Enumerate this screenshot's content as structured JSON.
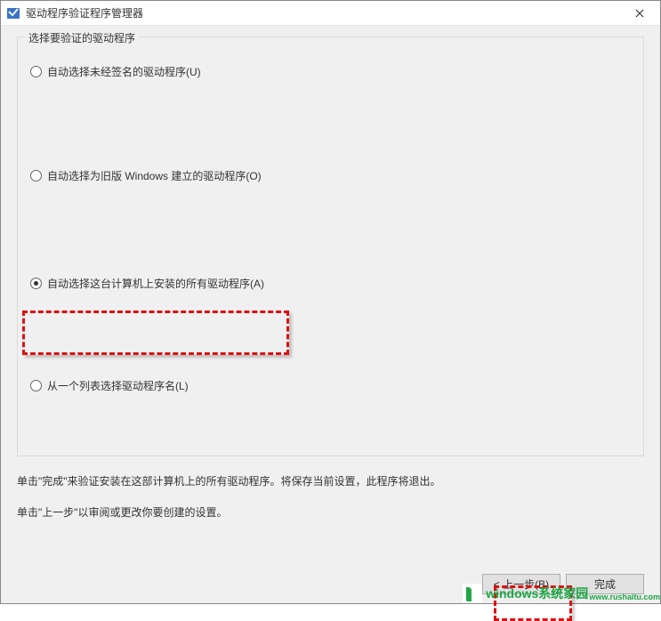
{
  "window": {
    "title": "驱动程序验证程序管理器"
  },
  "group": {
    "legend": "选择要验证的驱动程序",
    "options": [
      {
        "label": "自动选择未经签名的驱动程序(U)",
        "selected": false
      },
      {
        "label": "自动选择为旧版 Windows 建立的驱动程序(O)",
        "selected": false
      },
      {
        "label": "自动选择这台计算机上安装的所有驱动程序(A)",
        "selected": true
      },
      {
        "label": "从一个列表选择驱动程序名(L)",
        "selected": false
      }
    ]
  },
  "description": {
    "line1": "单击\"完成\"来验证安装在这部计算机上的所有驱动程序。将保存当前设置，此程序将退出。",
    "line2": "单击\"上一步\"以审阅或更改你要创建的设置。"
  },
  "buttons": {
    "back": "< 上一步(B)",
    "finish": "完成"
  },
  "watermark": {
    "brand": "windows系统家园",
    "sub": "www.rushaitu.com"
  }
}
